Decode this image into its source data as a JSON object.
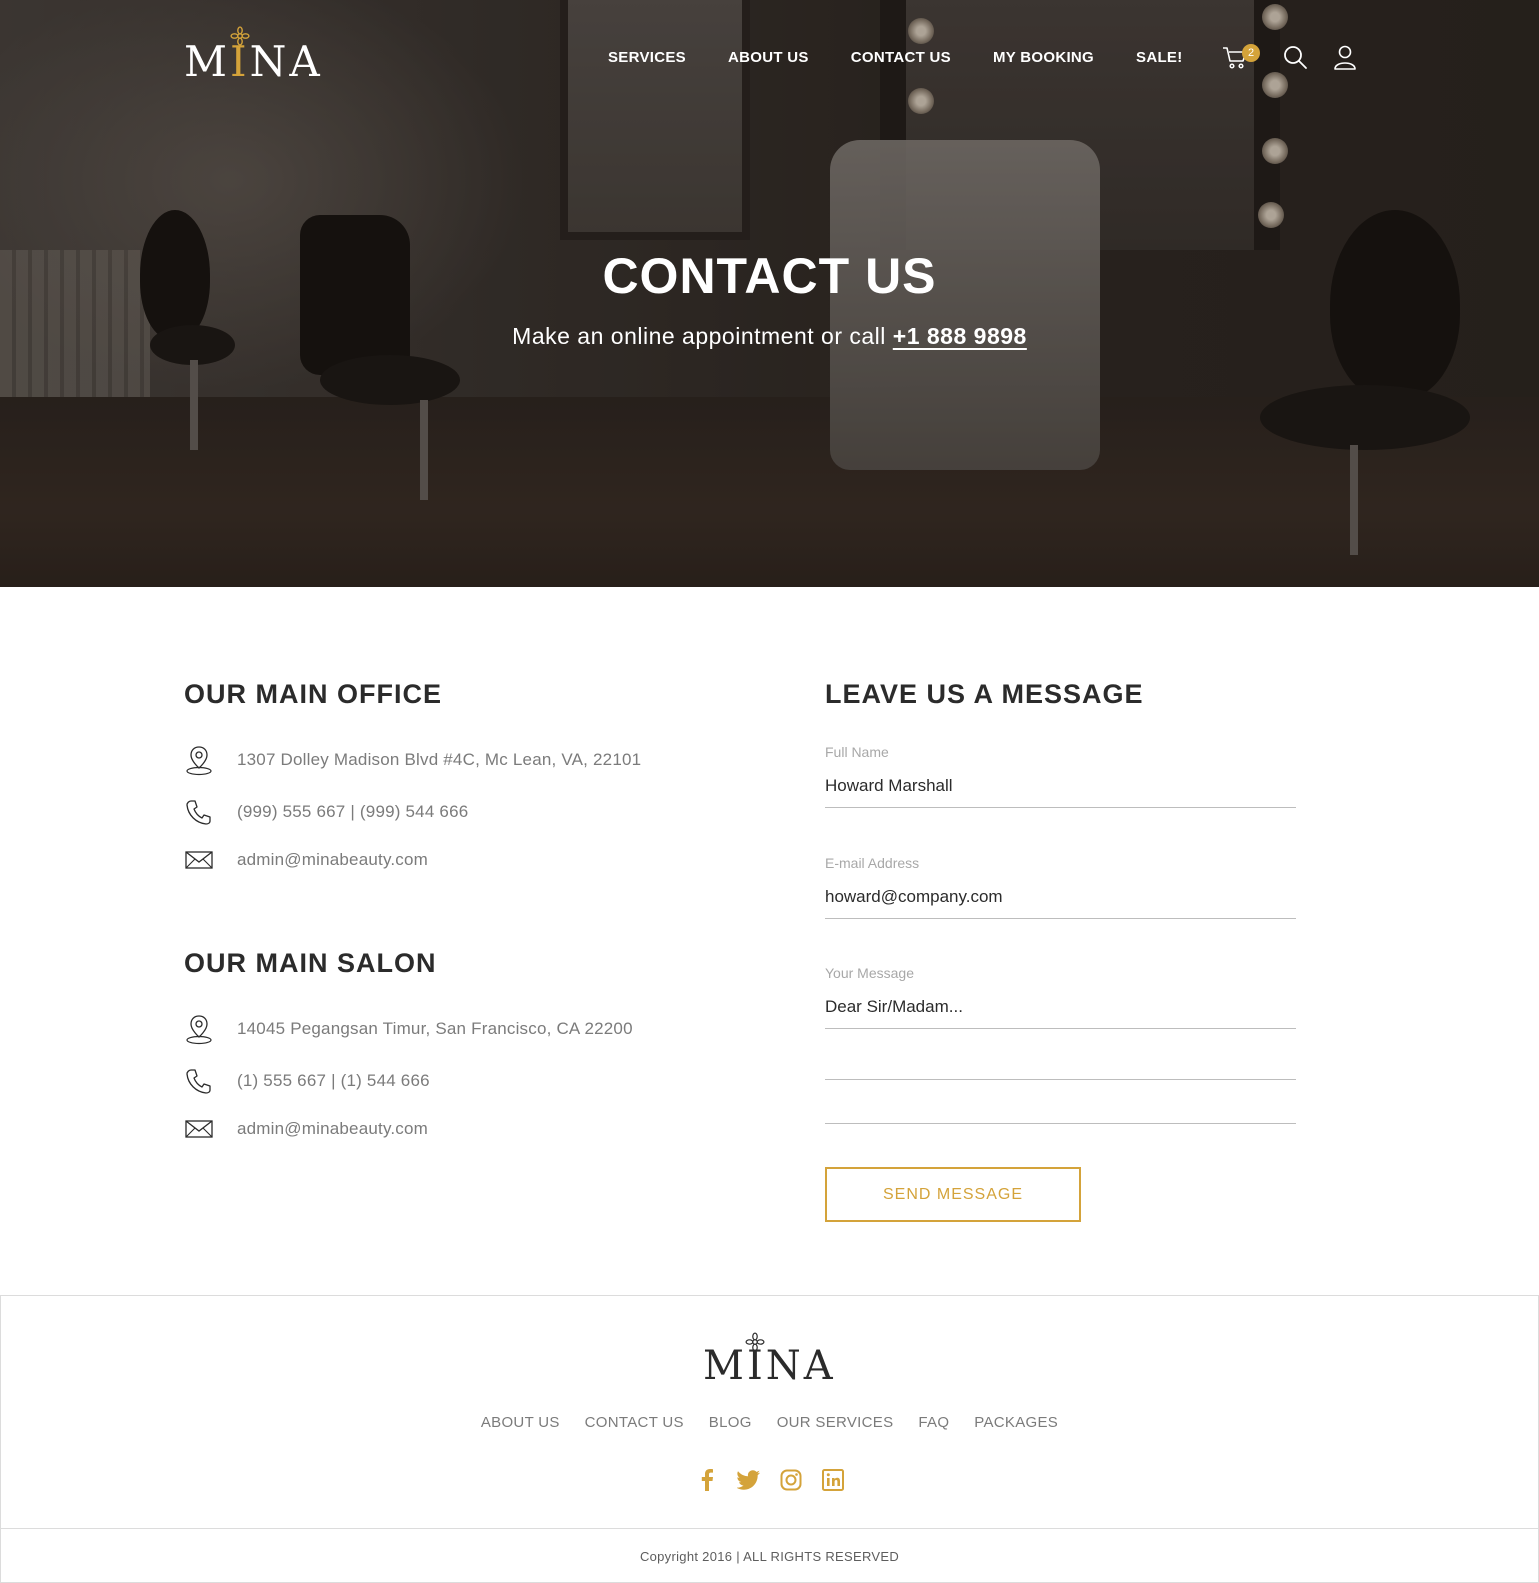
{
  "brand": {
    "logo_text": "MINA",
    "logo_letters": [
      "M",
      "I",
      "NA"
    ]
  },
  "nav": {
    "items": [
      "SERVICES",
      "ABOUT US",
      "CONTACT US",
      "MY BOOKING",
      "SALE!"
    ],
    "cart_count": "2",
    "icons": [
      "cart-icon",
      "search-icon",
      "user-icon"
    ]
  },
  "hero": {
    "title_bold": "CONTACT",
    "title_light": "US",
    "subtitle": "Make an online appointment or call",
    "phone": "+1 888 9898"
  },
  "office": {
    "title": "OUR MAIN OFFICE",
    "address": "1307 Dolley Madison Blvd #4C, Mc Lean, VA, 22101",
    "phone": "(999) 555 667 | (999) 544 666",
    "email": "admin@minabeauty.com"
  },
  "salon": {
    "title": "OUR MAIN SALON",
    "address": "14045 Pegangsan Timur, San Francisco, CA 22200",
    "phone": "(1) 555 667 | (1) 544 666",
    "email": "admin@minabeauty.com"
  },
  "form": {
    "title": "LEAVE US A MESSAGE",
    "name_label": "Full Name",
    "name_value": "Howard Marshall",
    "email_label": "E-mail Address",
    "email_value": "howard@company.com",
    "message_label": "Your Message",
    "message_value": "Dear Sir/Madam...",
    "submit_label": "SEND MESSAGE"
  },
  "footer": {
    "links": [
      "ABOUT US",
      "CONTACT US",
      "BLOG",
      "OUR SERVICES",
      "FAQ",
      "PACKAGES"
    ],
    "social_icons": [
      "facebook-icon",
      "twitter-icon",
      "instagram-icon",
      "linkedin-icon"
    ],
    "copyright": "Copyright 2016 | ALL RIGHTS RESERVED"
  },
  "colors": {
    "accent": "#d4a33a",
    "text_dark": "#2b2b2b",
    "text_muted": "#7b7b7b"
  }
}
